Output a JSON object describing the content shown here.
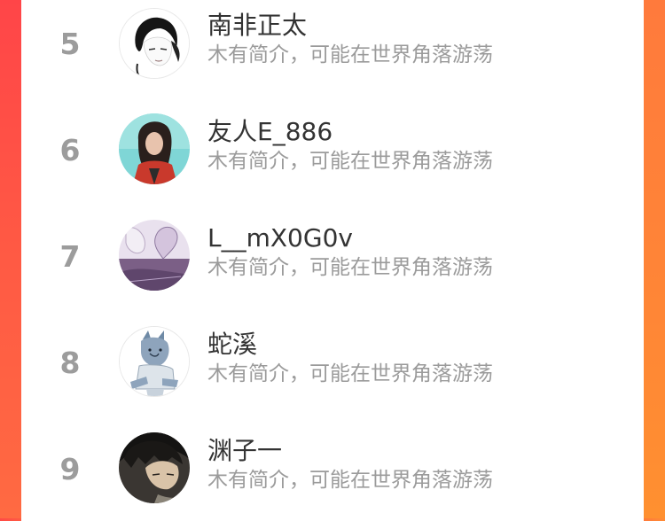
{
  "ranking": {
    "items": [
      {
        "rank": "5",
        "name": "南非正太",
        "bio": "木有简介，可能在世界角落游荡",
        "avatar_icon": "avatar-sketch-girl"
      },
      {
        "rank": "6",
        "name": "友人E_886",
        "bio": "木有简介，可能在世界角落游荡",
        "avatar_icon": "avatar-photo-woman-red-jacket"
      },
      {
        "rank": "7",
        "name": "L__mX0G0v",
        "bio": "木有简介，可能在世界角落游荡",
        "avatar_icon": "avatar-photo-purple-heart-hands"
      },
      {
        "rank": "8",
        "name": "蛇溪",
        "bio": "木有简介，可能在世界角落游荡",
        "avatar_icon": "avatar-wolf-illustration"
      },
      {
        "rank": "9",
        "name": "渊子一",
        "bio": "木有简介，可能在世界角落游荡",
        "avatar_icon": "avatar-anime-boy"
      }
    ]
  },
  "colors": {
    "left_accent": "#ff4a45",
    "right_accent": "#ff8636",
    "rank": "#9c9c9c",
    "name": "#333333",
    "bio": "#9b9b9b"
  }
}
